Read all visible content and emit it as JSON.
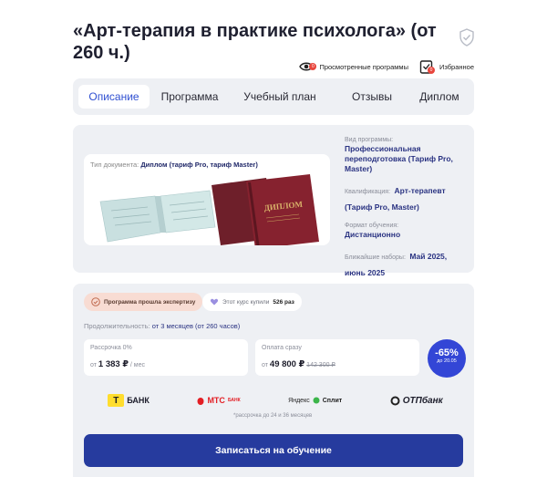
{
  "title": "«Арт-терапия в практике психолога» (от 260 ч.)",
  "topbar": {
    "viewed_label": "Просмотренные программы",
    "viewed_count": "0",
    "favorites_label": "Избранное",
    "favorites_count": "0"
  },
  "tabs": [
    {
      "label": "Описание",
      "active": true
    },
    {
      "label": "Программа"
    },
    {
      "label": "Учебный план"
    },
    {
      "label": "Отзывы"
    },
    {
      "label": "Диплом"
    }
  ],
  "document": {
    "type_label": "Тип документа:",
    "type_value": "Диплом (тариф Pro, тариф Master)"
  },
  "specs": [
    {
      "label": "Вид программы:",
      "value": "Профессиональная переподготовка (Тариф Pro, Master)"
    },
    {
      "label": "Квалификация:",
      "value": "Арт-терапевт (Тариф Pro, Master)"
    },
    {
      "label": "Формат обучения:",
      "value": "Дистанционно"
    },
    {
      "label": "Ближайшие наборы:",
      "value": "Май 2025, июнь 2025"
    }
  ],
  "badges": {
    "expert": "Программа прошла экспертизу",
    "bought_prefix": "Этот курс купили",
    "bought_count": "526 раз"
  },
  "duration": {
    "label": "Продолжительность:",
    "value": "от 3 месяцев (от 260 часов)"
  },
  "installment": {
    "label": "Рассрочка 0%",
    "prefix": "от",
    "price": "1 383 ₽",
    "suffix": "/ мес"
  },
  "full_payment": {
    "label": "Оплата сразу",
    "prefix": "от",
    "price": "49 800 ₽",
    "old_price": "142 300 ₽"
  },
  "discount": {
    "percent": "-65%",
    "until": "до 20.05",
    "color": "#3346d6"
  },
  "banks": {
    "tbank": "БАНК",
    "tbank_logo": "Т",
    "mts": "МТС",
    "mts_small": "БАНК",
    "yandex_a": "Яндекс",
    "yandex_b": "Сплит",
    "otp": "ОТПбанк"
  },
  "note": "*рассрочка до 24 и 36 месяцев",
  "cta": "Записаться на обучение",
  "colors": {
    "accent": "#2f4fd1",
    "cta": "#263b9e",
    "panel": "#eef0f4",
    "expert_pill": "#f8dcd3"
  }
}
